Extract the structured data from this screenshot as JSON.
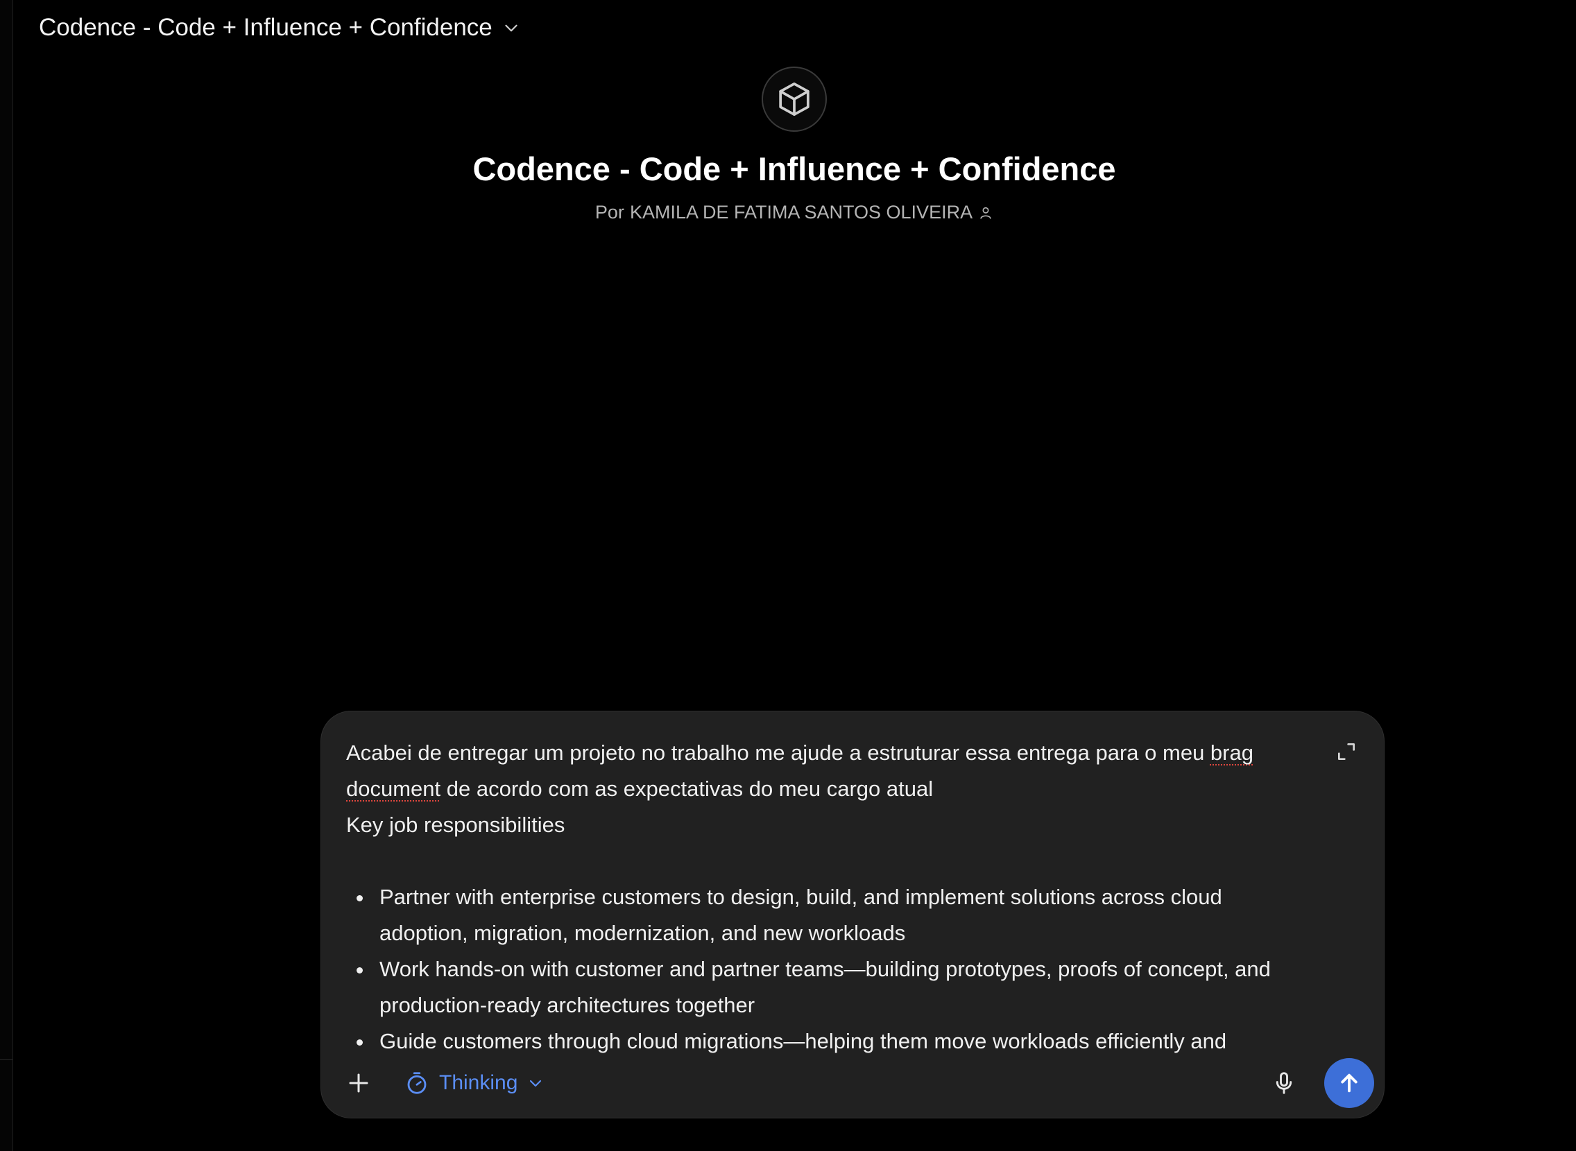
{
  "header": {
    "gpt_selector_label": "Codence - Code + Influence + Confidence",
    "chevron_icon": "chevron-down-icon"
  },
  "hero": {
    "avatar_icon": "cube-icon",
    "title": "Codence - Code + Influence + Confidence",
    "author_prefix": "Por",
    "author_name": "KAMILA DE FATIMA SANTOS OLIVEIRA",
    "author_icon": "person-icon"
  },
  "composer": {
    "line1_start": "Acabei de entregar um projeto no trabalho me ajude a estruturar essa entrega para o meu ",
    "misspelled_1": "brag",
    "misspelled_2": "document",
    "line2_end": " de acordo com as expectativas do meu cargo atual",
    "section_heading": "Key job responsibilities",
    "bullets": [
      "Partner with enterprise customers to design, build, and implement solutions across cloud adoption, migration, modernization, and new workloads",
      "Work hands-on with customer and partner teams—building prototypes, proofs of concept, and production-ready architectures together",
      "Guide customers through cloud migrations—helping them move workloads efficiently and"
    ],
    "expand_icon": "expand-icon",
    "add_icon": "plus-icon",
    "mode_label": "Thinking",
    "mode_icon": "timer-icon",
    "mic_icon": "microphone-icon",
    "send_icon": "arrow-up-icon"
  },
  "colors": {
    "background": "#000000",
    "composer_bg": "#212121",
    "accent_blue": "#3d6fd8",
    "thinking_blue": "#5b8ef5"
  }
}
